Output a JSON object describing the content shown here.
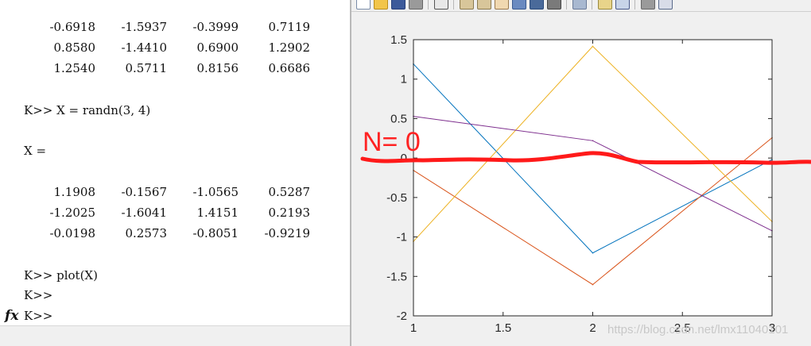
{
  "command_window": {
    "matrix_prev_rows": [
      [
        "-0.6918",
        "-1.5937",
        "-0.3999",
        "0.7119"
      ],
      [
        "0.8580",
        "-1.4410",
        "0.6900",
        "1.2902"
      ],
      [
        "1.2540",
        "0.5711",
        "0.8156",
        "0.6686"
      ]
    ],
    "cmd_randn": "K>> X = randn(3, 4)",
    "x_header": "X =",
    "matrix_x_rows": [
      [
        "1.1908",
        "-0.1567",
        "-1.0565",
        "0.5287"
      ],
      [
        "-1.2025",
        "-1.6041",
        "1.4151",
        "0.2193"
      ],
      [
        "-0.0198",
        "0.2573",
        "-0.8051",
        "-0.9219"
      ]
    ],
    "cmd_plot": "K>> plot(X)",
    "prompt_1": "K>>",
    "prompt_2": "K>>",
    "fx_icon": "fx-icon"
  },
  "figure": {
    "toolbar_icons": [
      "new-file-icon",
      "open-folder-icon",
      "save-icon",
      "print-icon",
      "pointer-icon",
      "zoom-in-icon",
      "zoom-out-icon",
      "pan-icon",
      "rotate-icon",
      "datatip-icon",
      "brush-icon",
      "link-icon",
      "colorbar-icon",
      "legend-icon",
      "hide-tools-icon",
      "dock-icon"
    ],
    "annotation": "N= 0",
    "annotation_color": "#ff2222",
    "watermark": "https://blog.csdn.net/lmx11040101"
  },
  "chart_data": {
    "type": "line",
    "x": [
      1,
      2,
      3
    ],
    "xlim": [
      1,
      3
    ],
    "ylim": [
      -2,
      1.5
    ],
    "xticks": [
      "1",
      "1.5",
      "2",
      "2.5",
      "3"
    ],
    "yticks": [
      "1.5",
      "1",
      "0.5",
      "0",
      "-0.5",
      "-1",
      "-1.5",
      "-2"
    ],
    "grid": false,
    "series": [
      {
        "values": [
          1.1908,
          -1.2025,
          -0.0198
        ],
        "color": "#0072BD"
      },
      {
        "values": [
          -0.1567,
          -1.6041,
          0.2573
        ],
        "color": "#D95319"
      },
      {
        "values": [
          -1.0565,
          1.4151,
          -0.8051
        ],
        "color": "#EDB120"
      },
      {
        "values": [
          0.5287,
          0.2193,
          -0.9219
        ],
        "color": "#7E2F8E"
      }
    ],
    "hand_drawn_line_y": 0
  }
}
